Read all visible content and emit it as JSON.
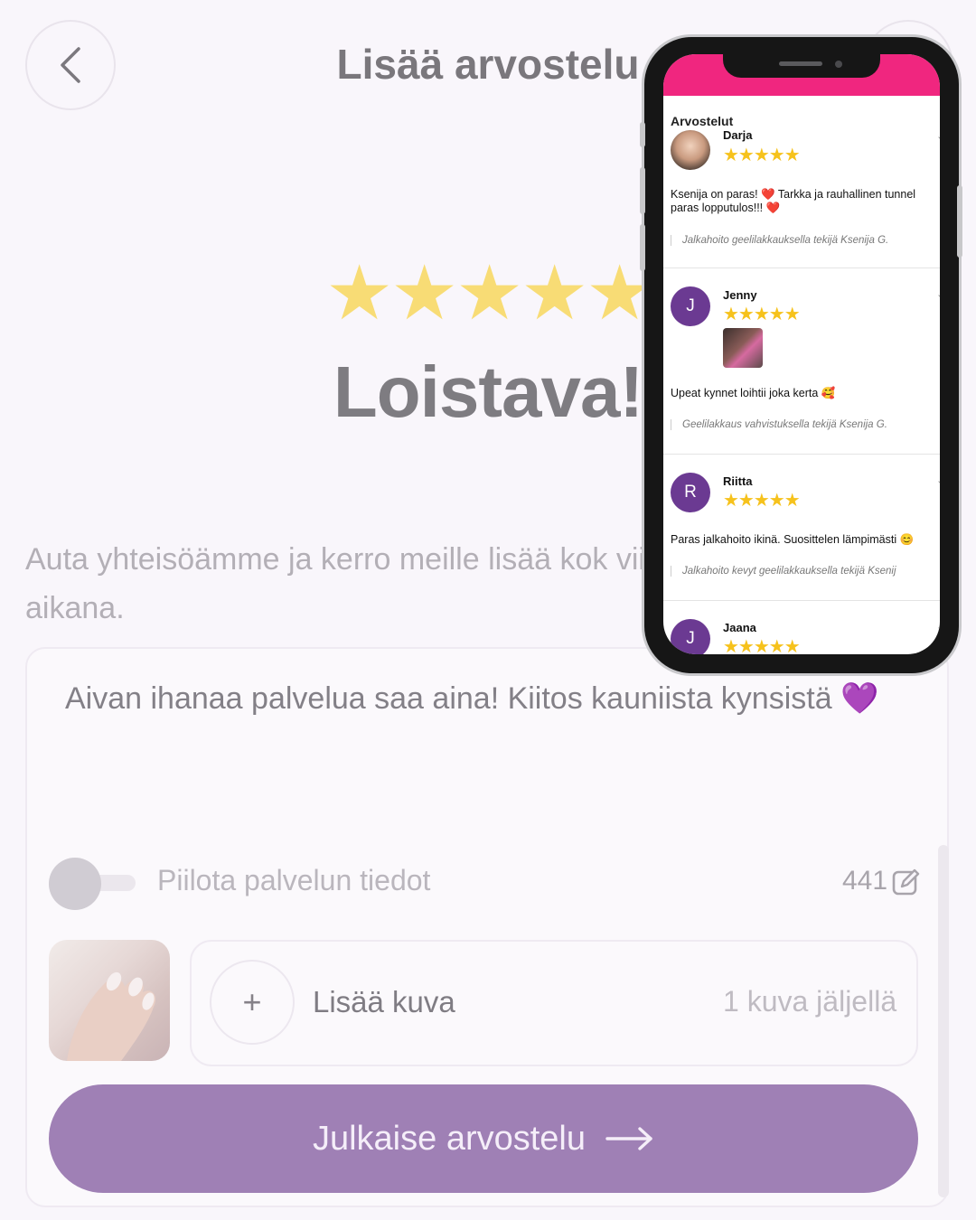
{
  "form": {
    "title": "Lisää arvostelu",
    "stars": [
      "★",
      "★",
      "★",
      "★",
      "★"
    ],
    "rating_word": "Loistava!",
    "prompt": "Auta yhteisöämme ja kerro meille lisää kok viimeisimmän käynnin aikana.",
    "review_text": "Aivan ihanaa palvelua saa aina! Kiitos kauniista kynsistä 💜",
    "hide_service_label": "Piilota palvelun tiedot",
    "char_count": "441",
    "add_photo_label": "Lisää kuva",
    "photos_remaining": "1 kuva jäljellä",
    "plus_symbol": "+",
    "publish_label": "Julkaise arvostelu",
    "back_icon": "chevron-left-icon",
    "edit_icon": "edit-icon",
    "arrow_icon": "arrow-right-icon"
  },
  "phone": {
    "accent_color": "#f0267f",
    "feed_title": "Arvostelut",
    "reviews": [
      {
        "name": "Darja",
        "avatar": "",
        "stars": "★★★★★",
        "text": "Ksenija on paras! ❤️ Tarkka ja rauhallinen tunnel paras lopputulos!!! ❤️",
        "service": "Jalkahoito geelilakkauksella tekijä Ksenija G."
      },
      {
        "name": "Jenny",
        "avatar": "J",
        "stars": "★★★★★",
        "text": "Upeat kynnet loihtii joka kerta 🥰",
        "service": "Geelilakkaus vahvistuksella tekijä Ksenija G."
      },
      {
        "name": "Riitta",
        "avatar": "R",
        "stars": "★★★★★",
        "text": "Paras jalkahoito ikinä. Suosittelen lämpimästi 😊",
        "service": "Jalkahoito kevyt geelilakkauksella tekijä Ksenij"
      },
      {
        "name": "Jaana",
        "avatar": "J",
        "stars": "★★★★★"
      }
    ]
  },
  "colors": {
    "publish_button": "#9f80b5",
    "stars_big": "#f8dc75",
    "avatar_purple": "#6b3a92",
    "phone_stars": "#f6c21c"
  }
}
